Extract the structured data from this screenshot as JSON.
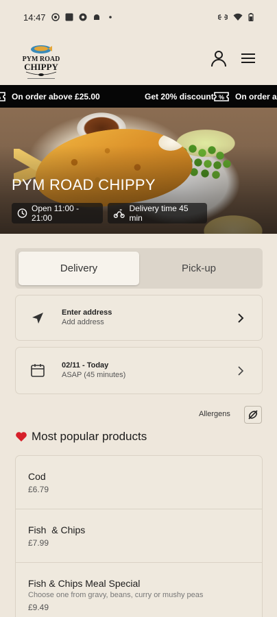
{
  "status_bar": {
    "time": "14:47"
  },
  "header": {
    "logo_line1": "PYM ROAD",
    "logo_line2": "CHIPPY"
  },
  "ticker": {
    "items": [
      "On order above £25.00",
      "Get 20% discount",
      "On order above"
    ]
  },
  "hero": {
    "title": "PYM ROAD CHIPPY",
    "open_hours": "Open 11:00 - 21:00",
    "delivery_time": "Delivery time 45 min"
  },
  "order_mode": {
    "options": [
      "Delivery",
      "Pick-up"
    ],
    "selected": "Delivery"
  },
  "address": {
    "title": "Enter address",
    "subtitle": "Add address"
  },
  "schedule": {
    "title": "02/11 - Today",
    "subtitle": "ASAP (45 minutes)"
  },
  "allergens": {
    "label": "Allergens"
  },
  "popular": {
    "heading": "Most popular products",
    "products": [
      {
        "name": "Cod",
        "description": "",
        "price": "£6.79"
      },
      {
        "name": "Fish  & Chips",
        "description": "",
        "price": "£7.99"
      },
      {
        "name": "Fish & Chips Meal Special",
        "description": "Choose one from gravy, beans, curry or mushy peas",
        "price": "£9.49"
      }
    ]
  },
  "colors": {
    "background": "#eee7dc",
    "ticker_bg": "#060606",
    "heart": "#d6202a"
  },
  "icons": [
    "account-icon",
    "hamburger-menu-icon",
    "coupon-icon",
    "clock-icon",
    "scooter-icon",
    "navigation-arrow-icon",
    "calendar-icon",
    "chevron-right-icon",
    "allergen-icon",
    "heart-icon"
  ]
}
